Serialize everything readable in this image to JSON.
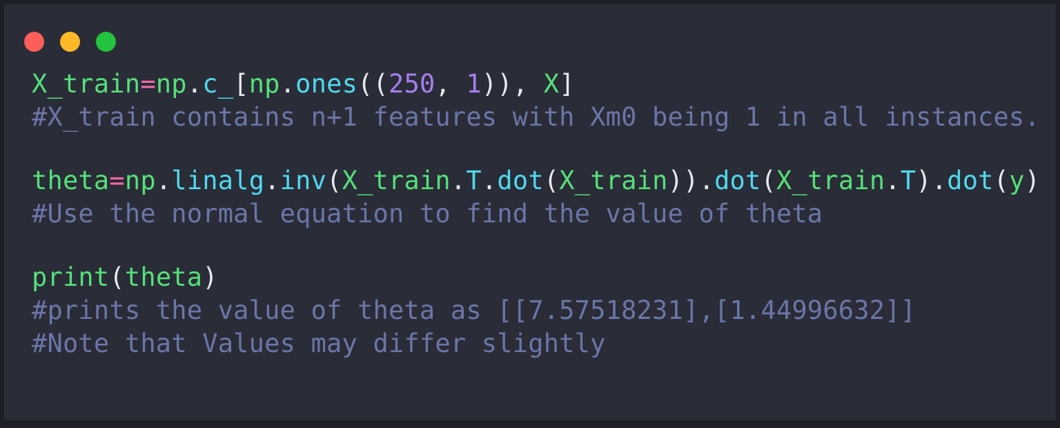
{
  "window": {
    "title_bar": {
      "traffic_lights": [
        {
          "name": "close",
          "color": "#fc5e5a"
        },
        {
          "name": "minimize",
          "color": "#fbb827"
        },
        {
          "name": "maximize",
          "color": "#22c33e"
        }
      ]
    },
    "theme": {
      "background": "#2a2c37",
      "page_background": "#1d1f27",
      "variable_color": "#55e07a",
      "function_color": "#50d9ef",
      "number_color": "#a77ef0",
      "operator_color": "#f56aa8",
      "punctuation_color": "#e8e8ef",
      "comment_color": "#6b76a8"
    }
  },
  "code": {
    "language": "python",
    "lines": [
      {
        "index": 1,
        "text": "X_train=np.c_[np.ones((250, 1)), X]",
        "tokens": [
          {
            "t": "X_train",
            "c": "var"
          },
          {
            "t": "=",
            "c": "op"
          },
          {
            "t": "np",
            "c": "var"
          },
          {
            "t": ".",
            "c": "punc"
          },
          {
            "t": "c_",
            "c": "fn"
          },
          {
            "t": "[",
            "c": "punc"
          },
          {
            "t": "np",
            "c": "var"
          },
          {
            "t": ".",
            "c": "punc"
          },
          {
            "t": "ones",
            "c": "fn"
          },
          {
            "t": "((",
            "c": "punc"
          },
          {
            "t": "250",
            "c": "num"
          },
          {
            "t": ", ",
            "c": "punc"
          },
          {
            "t": "1",
            "c": "num"
          },
          {
            "t": ")), ",
            "c": "punc"
          },
          {
            "t": "X",
            "c": "var"
          },
          {
            "t": "]",
            "c": "punc"
          }
        ]
      },
      {
        "index": 2,
        "text": "#X_train contains n+1 features with Xm0 being 1 in all instances.",
        "tokens": [
          {
            "t": "#X_train contains n+1 features with Xm0 being 1 in all instances.",
            "c": "cmt"
          }
        ]
      },
      {
        "index": 3,
        "text": "",
        "tokens": []
      },
      {
        "index": 4,
        "text": "theta=np.linalg.inv(X_train.T.dot(X_train)).dot(X_train.T).dot(y)",
        "tokens": [
          {
            "t": "theta",
            "c": "var"
          },
          {
            "t": "=",
            "c": "op"
          },
          {
            "t": "np",
            "c": "var"
          },
          {
            "t": ".",
            "c": "punc"
          },
          {
            "t": "linalg",
            "c": "fn"
          },
          {
            "t": ".",
            "c": "punc"
          },
          {
            "t": "inv",
            "c": "fn"
          },
          {
            "t": "(",
            "c": "punc"
          },
          {
            "t": "X_train",
            "c": "var"
          },
          {
            "t": ".",
            "c": "punc"
          },
          {
            "t": "T",
            "c": "fn"
          },
          {
            "t": ".",
            "c": "punc"
          },
          {
            "t": "dot",
            "c": "fn"
          },
          {
            "t": "(",
            "c": "punc"
          },
          {
            "t": "X_train",
            "c": "var"
          },
          {
            "t": "))",
            "c": "punc"
          },
          {
            "t": ".",
            "c": "punc"
          },
          {
            "t": "dot",
            "c": "fn"
          },
          {
            "t": "(",
            "c": "punc"
          },
          {
            "t": "X_train",
            "c": "var"
          },
          {
            "t": ".",
            "c": "punc"
          },
          {
            "t": "T",
            "c": "fn"
          },
          {
            "t": ")",
            "c": "punc"
          },
          {
            "t": ".",
            "c": "punc"
          },
          {
            "t": "dot",
            "c": "fn"
          },
          {
            "t": "(",
            "c": "punc"
          },
          {
            "t": "y",
            "c": "var"
          },
          {
            "t": ")",
            "c": "punc"
          }
        ]
      },
      {
        "index": 5,
        "text": "#Use the normal equation to find the value of theta",
        "tokens": [
          {
            "t": "#Use the normal equation to find the value of theta",
            "c": "cmt"
          }
        ]
      },
      {
        "index": 6,
        "text": "",
        "tokens": []
      },
      {
        "index": 7,
        "text": "print(theta)",
        "tokens": [
          {
            "t": "print",
            "c": "var"
          },
          {
            "t": "(",
            "c": "punc"
          },
          {
            "t": "theta",
            "c": "var"
          },
          {
            "t": ")",
            "c": "punc"
          }
        ]
      },
      {
        "index": 8,
        "text": "#prints the value of theta as [[7.57518231],[1.44996632]]",
        "tokens": [
          {
            "t": "#prints the value of theta as [[7.57518231],[1.44996632]]",
            "c": "cmt"
          }
        ]
      },
      {
        "index": 9,
        "text": "#Note that Values may differ slightly",
        "tokens": [
          {
            "t": "#Note that Values may differ slightly",
            "c": "cmt"
          }
        ]
      }
    ]
  }
}
